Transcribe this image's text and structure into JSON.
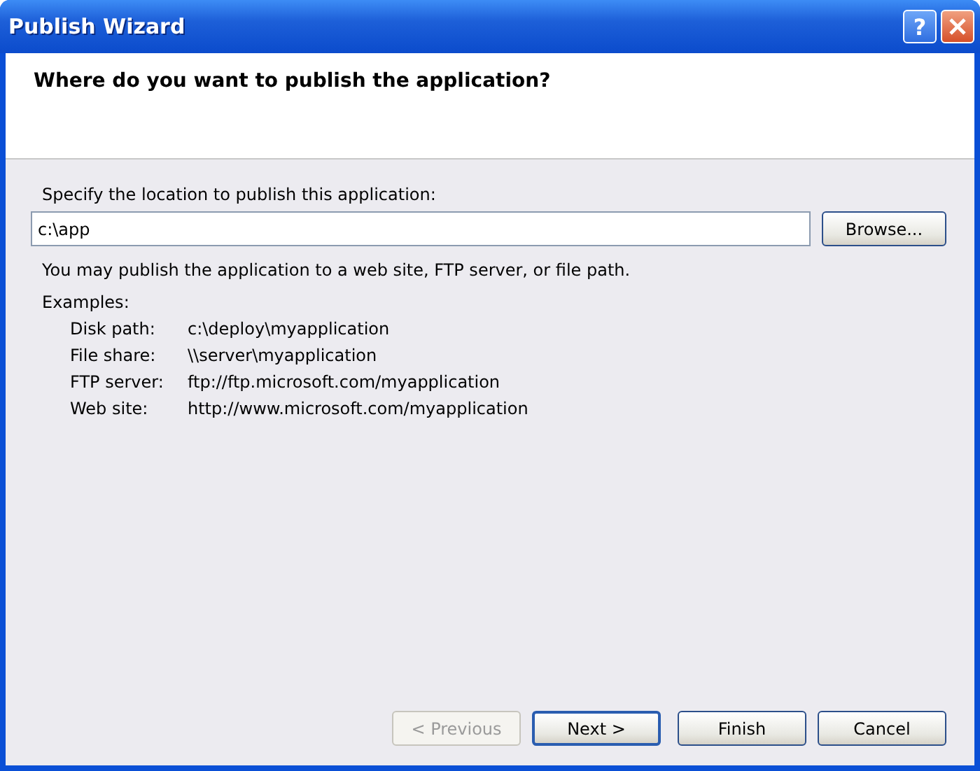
{
  "window": {
    "title": "Publish Wizard",
    "help_button": "?"
  },
  "header": {
    "question": "Where do you want to publish the application?"
  },
  "location": {
    "label": "Specify the location to publish this application:",
    "value": "c:\\app",
    "browse_button": "Browse..."
  },
  "description": "You may publish the application to a web site, FTP server, or file path.",
  "examples": {
    "heading": "Examples:",
    "rows": [
      {
        "label": "Disk path:",
        "value": "c:\\deploy\\myapplication"
      },
      {
        "label": "File share:",
        "value": "\\\\server\\myapplication"
      },
      {
        "label": "FTP server:",
        "value": "ftp://ftp.microsoft.com/myapplication"
      },
      {
        "label": "Web site:",
        "value": "http://www.microsoft.com/myapplication"
      }
    ]
  },
  "buttons": [
    {
      "label": "< Previous",
      "disabled": true,
      "default": false
    },
    {
      "label": "Next >",
      "disabled": false,
      "default": true
    },
    {
      "label": "Finish",
      "disabled": false,
      "default": false
    },
    {
      "label": "Cancel",
      "disabled": false,
      "default": false
    }
  ]
}
